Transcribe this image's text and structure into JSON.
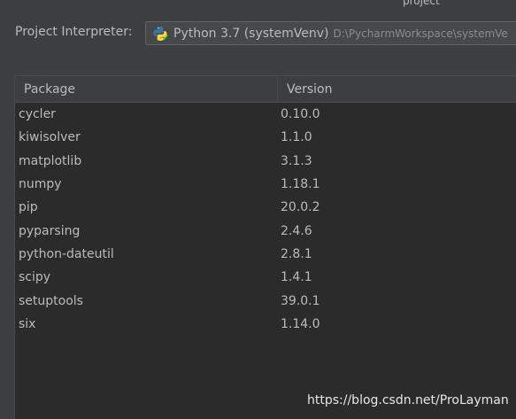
{
  "header": {
    "top_sliver_text": "project"
  },
  "interpreter": {
    "label": "Project Interpreter:",
    "name": "Python 3.7 (systemVenv)",
    "path": "D:\\PycharmWorkspace\\systemVe"
  },
  "table": {
    "columns": [
      "Package",
      "Version"
    ],
    "rows": [
      {
        "package": "cycler",
        "version": "0.10.0"
      },
      {
        "package": "kiwisolver",
        "version": "1.1.0"
      },
      {
        "package": "matplotlib",
        "version": "3.1.3"
      },
      {
        "package": "numpy",
        "version": "1.18.1"
      },
      {
        "package": "pip",
        "version": "20.0.2"
      },
      {
        "package": "pyparsing",
        "version": "2.4.6"
      },
      {
        "package": "python-dateutil",
        "version": "2.8.1"
      },
      {
        "package": "scipy",
        "version": "1.4.1"
      },
      {
        "package": "setuptools",
        "version": "39.0.1"
      },
      {
        "package": "six",
        "version": "1.14.0"
      }
    ]
  },
  "watermark": "https://blog.csdn.net/ProLayman",
  "colors": {
    "background": "#3c3f41",
    "table_background": "#2b2b2b",
    "text": "#bbbbbb",
    "python_blue": "#3776ab",
    "python_yellow": "#ffd43b"
  }
}
